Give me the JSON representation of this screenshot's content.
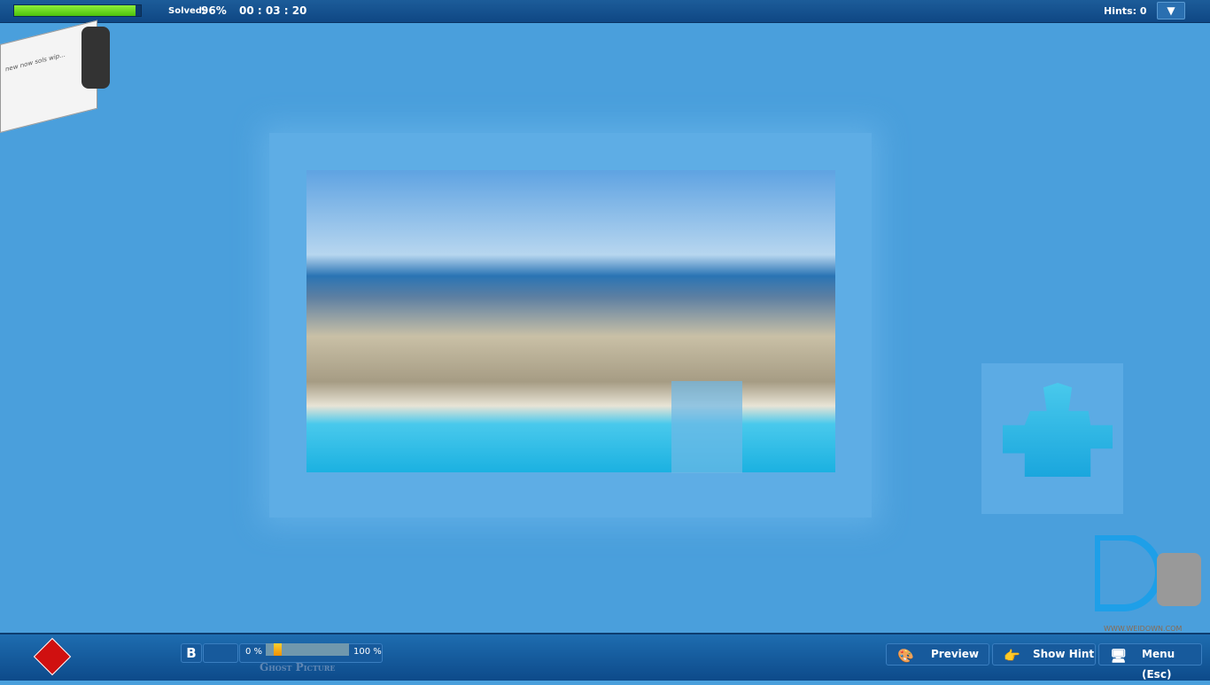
{
  "topbar": {
    "progress_percent": 96,
    "solved_label": "Solved:",
    "solved_value": "96%",
    "timer": "00 : 03 : 20",
    "hints_label": "Hints: 0",
    "dropdown_icon": "triangle-down-icon"
  },
  "notes": {
    "text": "new now sols wip..."
  },
  "bottombar": {
    "b_button": "B",
    "ghost_min": "0 %",
    "ghost_max": "100 %",
    "ghost_value_percent": 10,
    "ghost_label": "Ghost Picture",
    "buttons": [
      {
        "label": "Preview",
        "icon": "palette-icon"
      },
      {
        "label": "Show Hint",
        "icon": "pointing-hand-icon"
      },
      {
        "label": "Menu (Esc)",
        "icon": "monitor-icon"
      }
    ]
  },
  "watermark": {
    "text": "WWW.WEIDOWN.COM"
  },
  "colors": {
    "background": "#4a9fdc",
    "bar": "#0f4784",
    "progress": "#6ad824"
  }
}
